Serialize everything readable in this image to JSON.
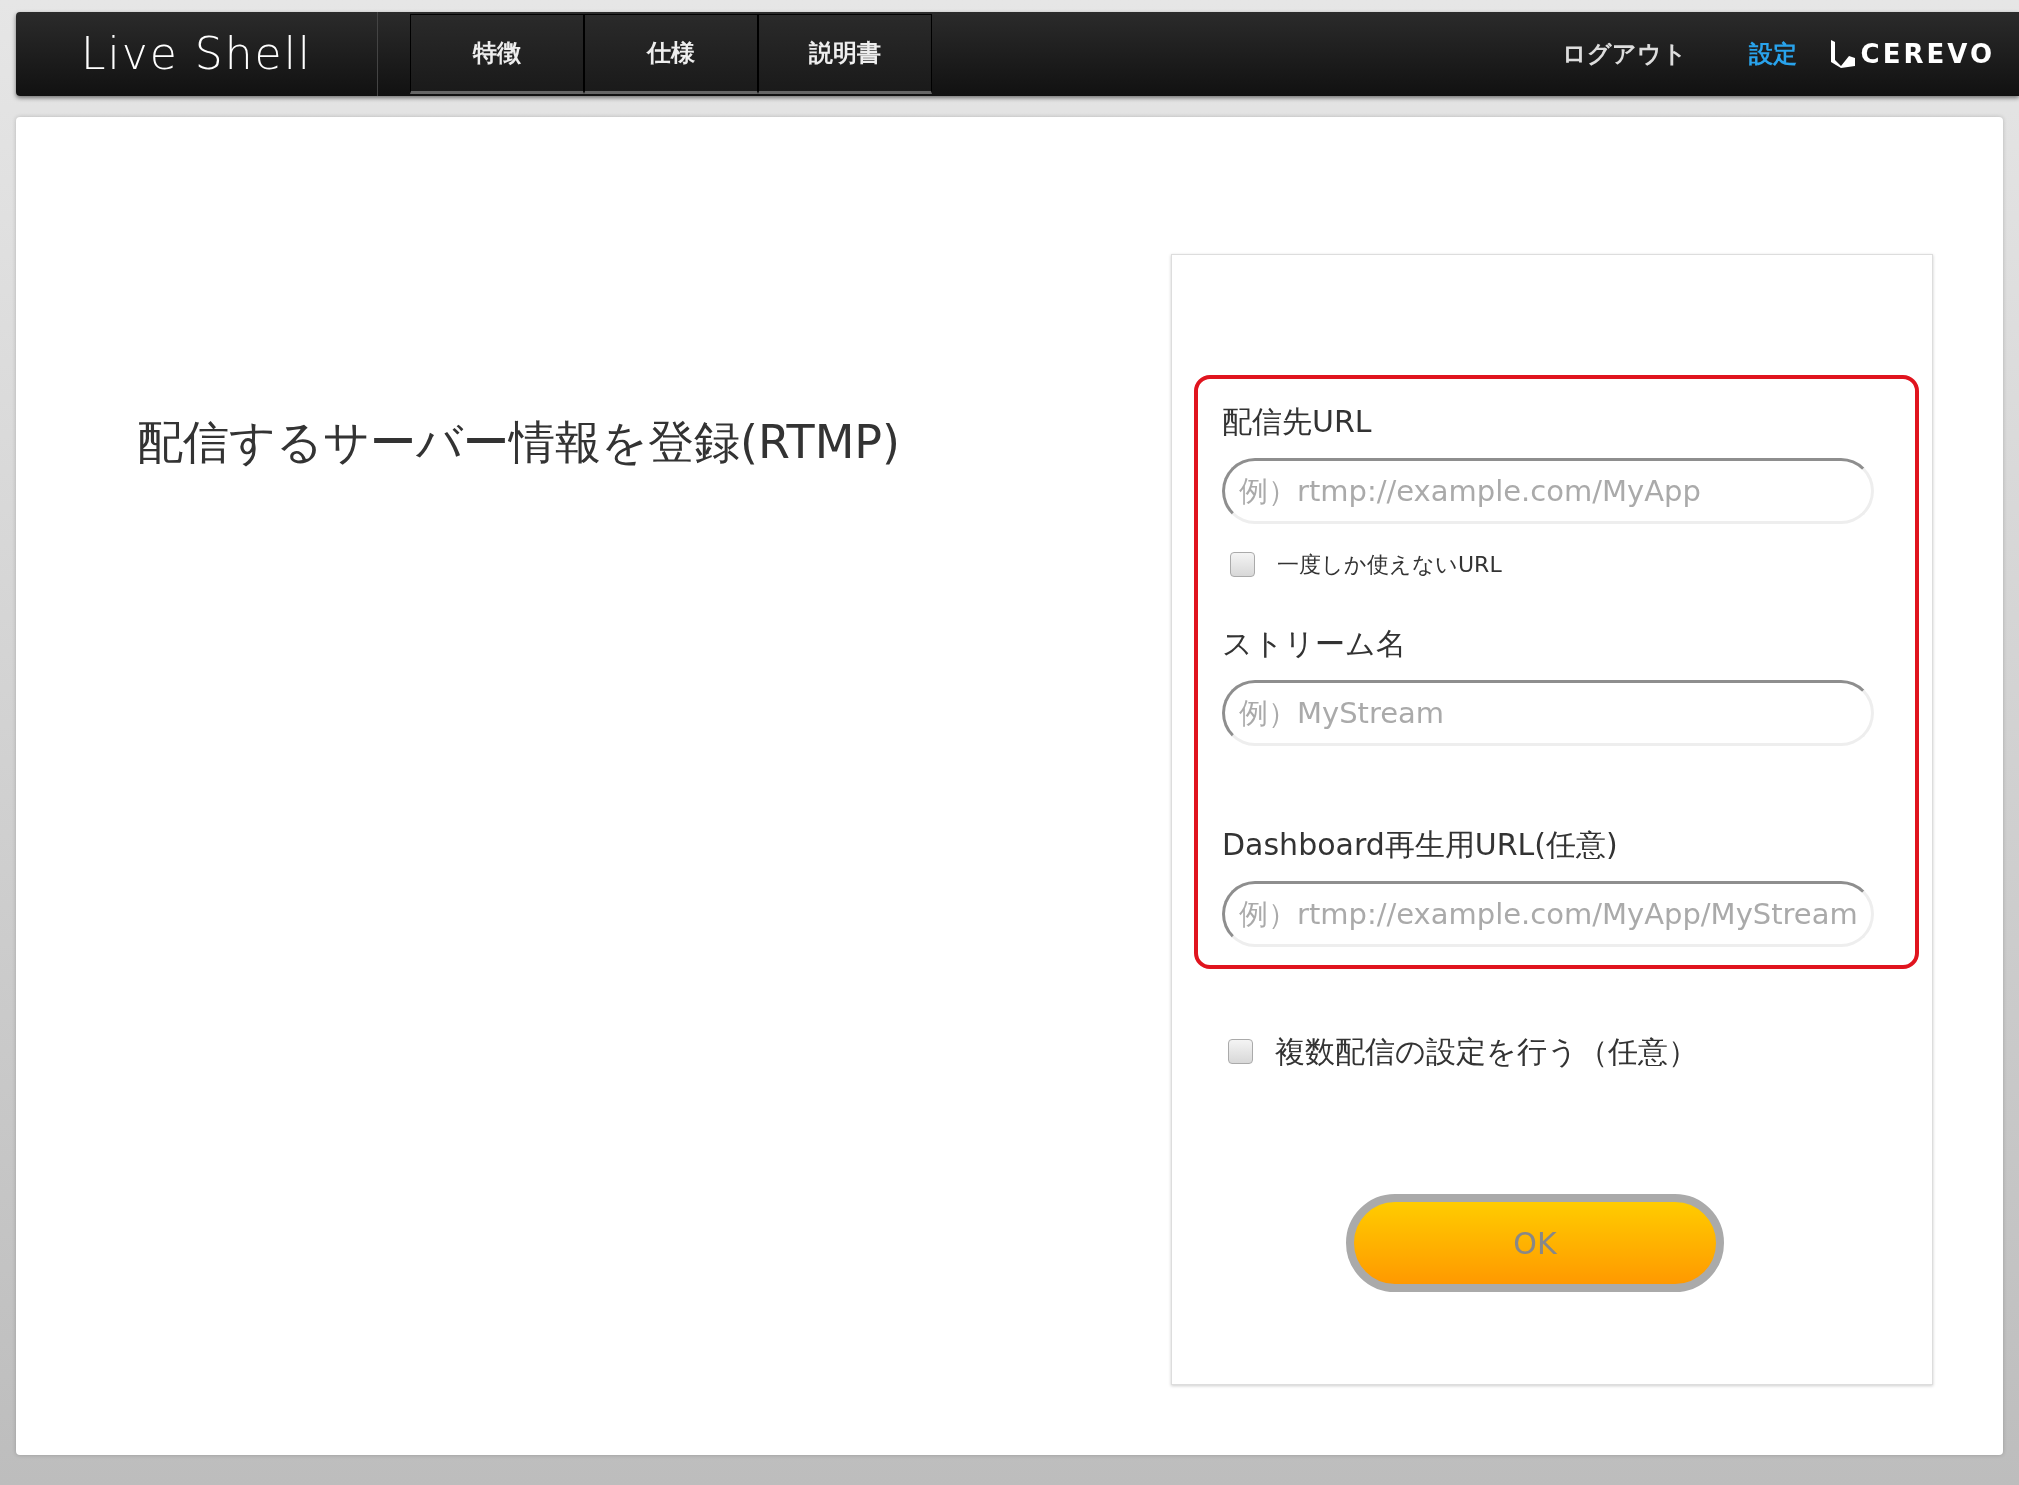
{
  "header": {
    "logo": "Live Shell",
    "tabs": [
      {
        "label": "特徴"
      },
      {
        "label": "仕様"
      },
      {
        "label": "説明書"
      }
    ],
    "links": [
      {
        "label": "ログアウト",
        "selected": false
      },
      {
        "label": "設定",
        "selected": true
      }
    ],
    "brand": "CEREVO"
  },
  "page_title": "配信するサーバー情報を登録(RTMP)",
  "form": {
    "fields": [
      {
        "label": "配信先URL",
        "placeholder": "例）rtmp://example.com/MyApp",
        "checkbox": {
          "label": "一度しか使えないURL",
          "checked": false
        }
      },
      {
        "label": "ストリーム名",
        "placeholder": "例）MyStream"
      },
      {
        "label": "Dashboard再生用URL(任意)",
        "placeholder": "例）rtmp://example.com/MyApp/MyStream"
      }
    ],
    "option": {
      "label": "複数配信の設定を行う（任意）",
      "checked": false
    },
    "submit": "OK"
  }
}
